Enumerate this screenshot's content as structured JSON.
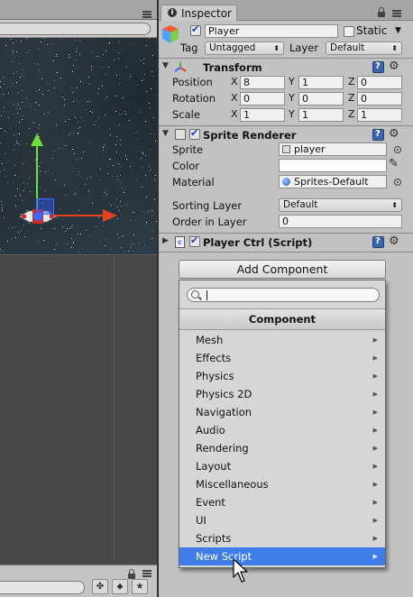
{
  "inspector": {
    "tab_label": "Inspector",
    "object_name": "Player",
    "static_label": "Static",
    "tag_label": "Tag",
    "tag_value": "Untagged",
    "layer_label": "Layer",
    "layer_value": "Default"
  },
  "transform": {
    "title": "Transform",
    "rows": [
      {
        "label": "Position",
        "x": "8",
        "y": "1",
        "z": "0"
      },
      {
        "label": "Rotation",
        "x": "0",
        "y": "0",
        "z": "0"
      },
      {
        "label": "Scale",
        "x": "1",
        "y": "1",
        "z": "1"
      }
    ],
    "axis_x": "X",
    "axis_y": "Y",
    "axis_z": "Z"
  },
  "sprite_renderer": {
    "title": "Sprite Renderer",
    "sprite_label": "Sprite",
    "sprite_value": "player",
    "color_label": "Color",
    "color_value": "#ffffff",
    "material_label": "Material",
    "material_value": "Sprites-Default",
    "sorting_layer_label": "Sorting Layer",
    "sorting_layer_value": "Default",
    "order_label": "Order in Layer",
    "order_value": "0"
  },
  "script_component": {
    "title": "Player Ctrl (Script)"
  },
  "add_component": {
    "button_label": "Add Component",
    "search_placeholder": "",
    "header": "Component",
    "items": [
      "Mesh",
      "Effects",
      "Physics",
      "Physics 2D",
      "Navigation",
      "Audio",
      "Rendering",
      "Layout",
      "Miscellaneous",
      "Event",
      "UI",
      "Scripts",
      "New Script"
    ],
    "selected_item": "New Script"
  },
  "colors": {
    "selection": "#3e7ce8",
    "gizmo_x": "#e8411f",
    "gizmo_y": "#6ee03a",
    "gizmo_center": "#3a6aff"
  }
}
